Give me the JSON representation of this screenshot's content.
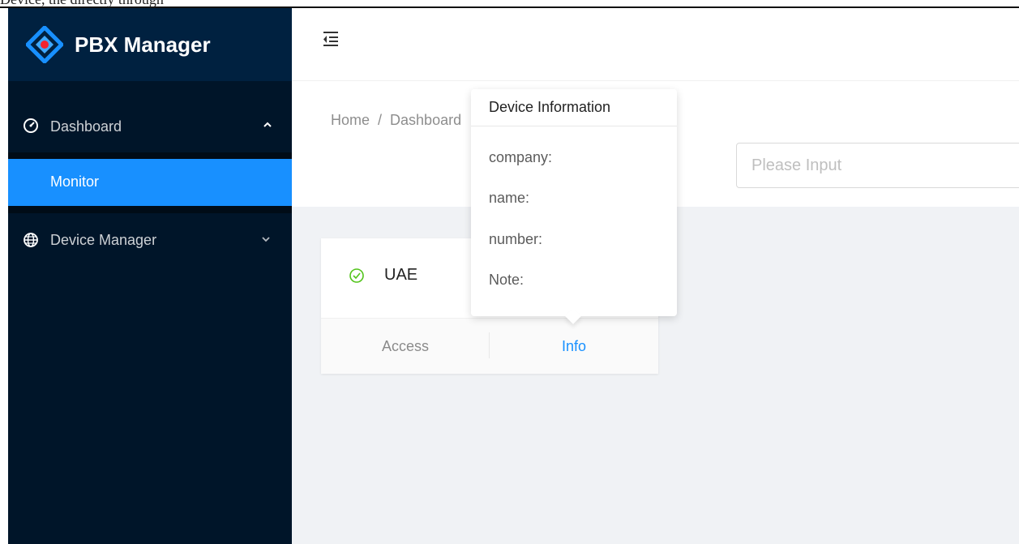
{
  "top_text": "Device, the directly through",
  "app": {
    "title": "PBX Manager"
  },
  "sidebar": {
    "items": [
      {
        "label": "Dashboard",
        "icon": "dashboard-icon",
        "expanded": true
      },
      {
        "label": "Monitor",
        "selected": true
      },
      {
        "label": "Device Manager",
        "icon": "globe-icon",
        "expanded": false
      }
    ]
  },
  "breadcrumb": {
    "home": "Home",
    "separator": "/",
    "current": "Dashboard"
  },
  "search": {
    "placeholder": "Please Input",
    "value": ""
  },
  "card": {
    "title": "UAE",
    "status": "online",
    "actions": {
      "access": "Access",
      "info": "Info"
    }
  },
  "popover": {
    "title": "Device Information",
    "fields": {
      "company": "company:",
      "name": "name:",
      "number": "number:",
      "note": "Note:"
    }
  },
  "colors": {
    "sider_bg": "#001529",
    "logo_bg": "#002140",
    "primary": "#1890ff",
    "success": "#52c41a",
    "content_bg": "#f0f2f5"
  }
}
